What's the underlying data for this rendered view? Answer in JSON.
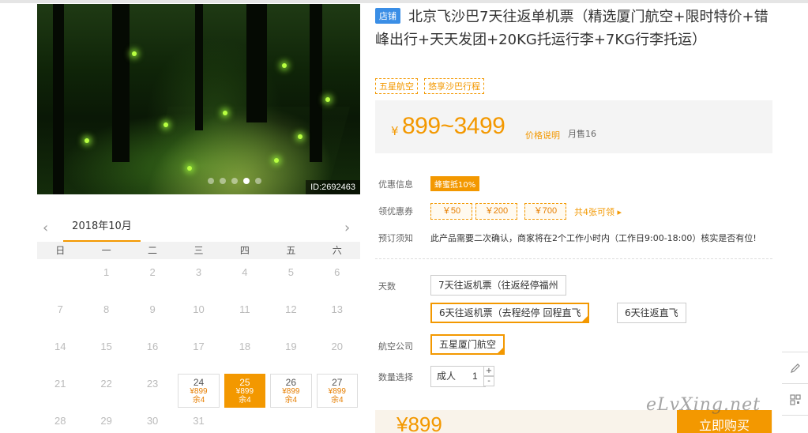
{
  "gallery": {
    "image_id": "ID:2692463",
    "slide_count": 5,
    "active_slide": 4
  },
  "calendar": {
    "month_label": "2018年10月",
    "weekdays": [
      "日",
      "一",
      "二",
      "三",
      "四",
      "五",
      "六"
    ],
    "days": [
      {
        "d": ""
      },
      {
        "d": "1"
      },
      {
        "d": "2"
      },
      {
        "d": "3"
      },
      {
        "d": "4"
      },
      {
        "d": "5"
      },
      {
        "d": "6"
      },
      {
        "d": "7"
      },
      {
        "d": "8"
      },
      {
        "d": "9"
      },
      {
        "d": "10"
      },
      {
        "d": "11"
      },
      {
        "d": "12"
      },
      {
        "d": "13"
      },
      {
        "d": "14"
      },
      {
        "d": "15"
      },
      {
        "d": "16"
      },
      {
        "d": "17"
      },
      {
        "d": "18"
      },
      {
        "d": "19"
      },
      {
        "d": "20"
      },
      {
        "d": "21"
      },
      {
        "d": "22"
      },
      {
        "d": "23"
      },
      {
        "d": "24",
        "price": "¥899",
        "remain": "余4"
      },
      {
        "d": "25",
        "price": "¥899",
        "remain": "余4",
        "selected": true
      },
      {
        "d": "26",
        "price": "¥899",
        "remain": "余4"
      },
      {
        "d": "27",
        "price": "¥899",
        "remain": "余4"
      },
      {
        "d": "28"
      },
      {
        "d": "29"
      },
      {
        "d": "30"
      },
      {
        "d": "31"
      }
    ]
  },
  "product": {
    "store_tag": "店铺",
    "title": "北京飞沙巴7天往返单机票（精选厦门航空+限时特价+错峰出行+天天发团+20KG托运行李+7KG行李托运）",
    "tags": [
      "五星航空",
      "悠享沙巴行程"
    ],
    "price": {
      "currency": "¥",
      "range": "899~3499",
      "desc_link": "价格说明",
      "monthly_sales": "月售16"
    }
  },
  "promo": {
    "label": "优惠信息",
    "badge": "蜂蜜抵10%"
  },
  "coupons": {
    "label": "领优惠券",
    "items": [
      "￥50",
      "￥200",
      "￥700"
    ],
    "more": "共4张可领 ▸"
  },
  "notice": {
    "label": "预订须知",
    "text": "此产品需要二次确认，商家将在2个工作小时内（工作日9:00-18:00）核实是否有位!"
  },
  "options": {
    "days_label": "天数",
    "days": [
      "7天往返机票（往返经停福州",
      "6天往返机票（去程经停 回程直飞",
      "6天往返直飞"
    ],
    "airline_label": "航空公司",
    "airline": "五星厦门航空",
    "qty_label": "数量选择",
    "qty_type": "成人",
    "qty_value": "1",
    "plus": "+",
    "minus": "-"
  },
  "footer": {
    "price": "¥899",
    "buy_label": "立即购买"
  },
  "watermark": "eLvXing.net",
  "colors": {
    "accent": "#f39800",
    "store_tag": "#3a8ee6"
  },
  "icons": [
    "chevron-left-icon",
    "chevron-right-icon",
    "pencil-icon",
    "qr-code-icon"
  ]
}
